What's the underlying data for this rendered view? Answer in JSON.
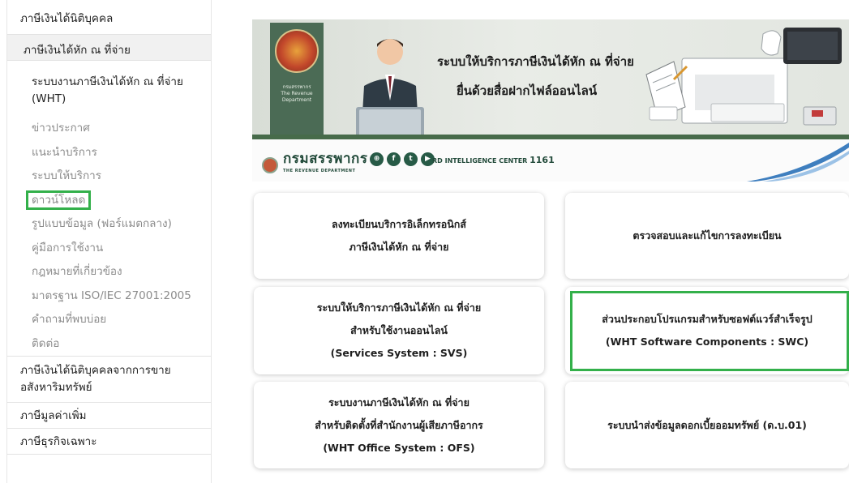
{
  "sidebar": {
    "top_item": "ภาษีเงินได้นิติบุคคล",
    "active_item": "ภาษีเงินได้หัก ณ ที่จ่าย",
    "sub_items": [
      "ระบบงานภาษีเงินได้หัก ณ ที่จ่าย (WHT)",
      "ข่าวประกาศ",
      "แนะนำบริการ",
      "ระบบให้บริการ",
      "ดาวน์โหลด",
      "รูปแบบข้อมูล (ฟอร์แมตกลาง)",
      "คู่มือการใช้งาน",
      "กฎหมายที่เกี่ยวข้อง",
      "มาตรฐาน ISO/IEC 27001:2005",
      "คำถามที่พบบ่อย",
      "ติดต่อ"
    ],
    "bottom_items": [
      "ภาษีเงินได้นิติบุคคลจากการขายอสังหาริมทรัพย์",
      "ภาษีมูลค่าเพิ่ม",
      "ภาษีธุรกิจเฉพาะ"
    ],
    "highlight_color": "#33b04a"
  },
  "banner": {
    "title_line1": "ระบบให้บริการภาษีเงินได้หัก ณ ที่จ่าย",
    "title_line2": "ยื่นด้วยสื่อฝากไฟล์ออนไลน์",
    "seal_text": "กรมสรรพากร",
    "seal_subtext": "The Revenue Department",
    "logo_name": "กรมสรรพากร",
    "logo_sub": "THE REVENUE DEPARTMENT",
    "social_icons": [
      "globe-icon",
      "facebook-icon",
      "twitter-icon",
      "youtube-icon"
    ],
    "rd_center_label": "RD INTELLIGENCE CENTER",
    "rd_center_number": "1161",
    "green_color": "#476b4a"
  },
  "cards": [
    {
      "lines": [
        "ลงทะเบียนบริการอิเล็กทรอนิกส์",
        "ภาษีเงินได้หัก ณ ที่จ่าย"
      ]
    },
    {
      "lines": [
        "ตรวจสอบและแก้ไขการลงทะเบียน"
      ]
    },
    {
      "lines": [
        "ระบบให้บริการภาษีเงินได้หัก ณ ที่จ่าย",
        "สำหรับใช้งานออนไลน์",
        "(Services System : SVS)"
      ]
    },
    {
      "lines": [
        "ส่วนประกอบโปรแกรมสำหรับซอฟต์แวร์สำเร็จรูป",
        "(WHT Software Components : SWC)"
      ]
    },
    {
      "lines": [
        "ระบบงานภาษีเงินได้หัก ณ ที่จ่าย",
        "สำหรับติดตั้งที่สำนักงานผู้เสียภาษีอากร",
        "(WHT Office System : OFS)"
      ]
    },
    {
      "lines": [
        "ระบบนำส่งข้อมูลดอกเบี้ยออมทรัพย์ (ด.บ.01)"
      ]
    }
  ]
}
